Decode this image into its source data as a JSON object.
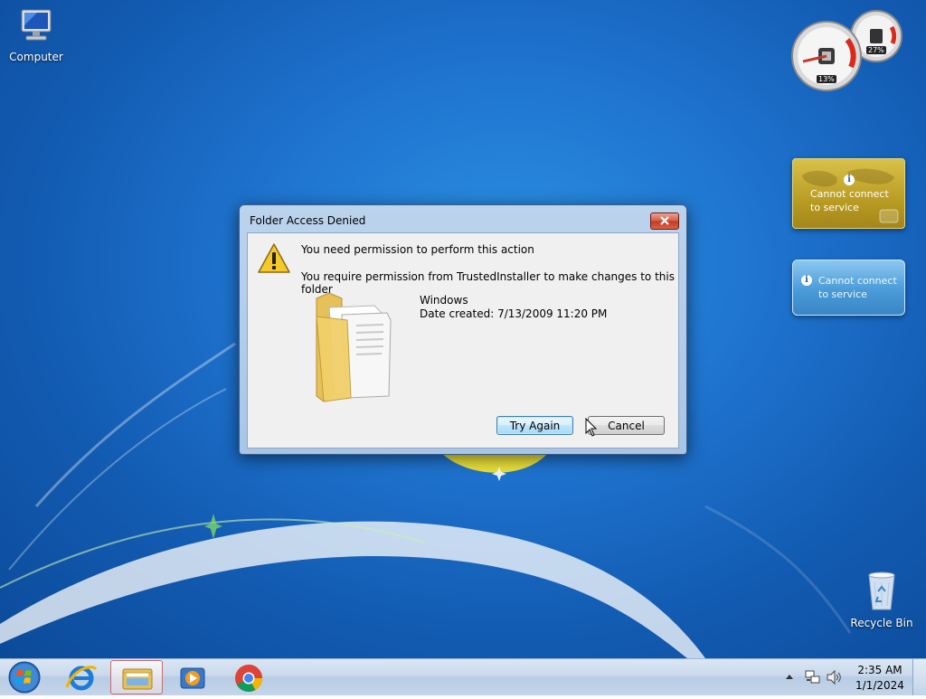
{
  "desktop": {
    "icons": [
      {
        "label": "Computer"
      },
      {
        "label": "Recycle Bin"
      }
    ]
  },
  "gadgets": {
    "cpu_meter": {
      "cpu_value": "13%",
      "memory_value": "27%"
    },
    "weather": {
      "message": "Cannot connect to service"
    },
    "feed": {
      "message": "Cannot connect to service"
    }
  },
  "dialog": {
    "title": "Folder Access Denied",
    "heading": "You need permission to perform this action",
    "detail": "You require permission from TrustedInstaller to make changes to this folder",
    "folder_name": "Windows",
    "folder_date": "Date created: 7/13/2009 11:20 PM",
    "try_again_label": "Try Again",
    "cancel_label": "Cancel"
  },
  "taskbar": {
    "pinned": [
      "start-orb-icon",
      "internet-explorer-icon",
      "windows-explorer-icon",
      "media-player-icon",
      "chrome-icon"
    ],
    "active_item": "windows-explorer-icon",
    "clock": {
      "time": "2:35 AM",
      "date": "1/1/2024"
    }
  },
  "colors": {
    "desktop_blue": "#1f74cf",
    "dialog_frame": "#a9c5e6",
    "close_red": "#c23a22",
    "weather_gold": "#b99c23",
    "feed_blue": "#4a9bd8"
  }
}
